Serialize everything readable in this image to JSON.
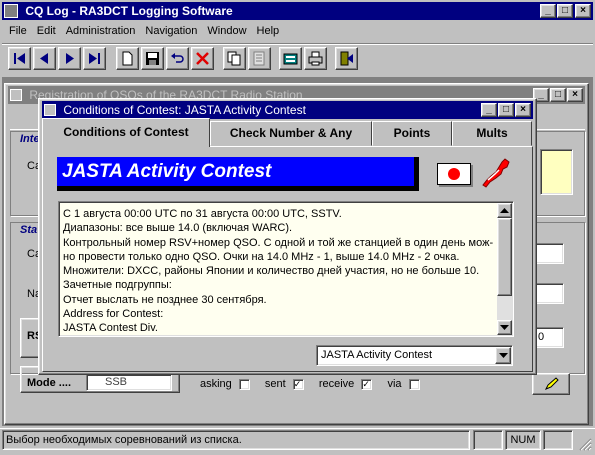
{
  "app": {
    "title": "CQ Log - RA3DCT Logging Software",
    "menu": [
      "File",
      "Edit",
      "Administration",
      "Navigation",
      "Window",
      "Help"
    ]
  },
  "background_window": {
    "title": "Registration of QSOs of the RA3DCT Radio Station",
    "group_top_label": "Inte",
    "row_label_c1": "Ca",
    "group_mid_label": "Sta",
    "row_label_c2": "Ca",
    "row_label_na": "Na",
    "row_label_rs": "RS",
    "mode_label": "Mode ....",
    "mode_value": "SSB",
    "check_asking": "asking",
    "check_sent": "sent",
    "check_receive": "receive",
    "check_via": "via",
    "side_value": "0"
  },
  "dialog": {
    "title": "Conditions of Contest: JASTA Activity Contest",
    "tabs": [
      "Conditions of Contest",
      "Check Number & Any",
      "Points",
      "Mults"
    ],
    "banner_title": "JASTA Activity Contest",
    "banner_color": "#0000ff",
    "flag_color": "#ff0000",
    "rules_lines": [
      "С 1 августа 00:00 UTC по 31 августа 00:00 UTC, SSTV.",
      "Диапазоны: все выше 14.0 (включая WARC).",
      "Контрольный номер RSV+номер QSO. С одной и той же станцией в один день мож-",
      "но провести только одно QSO. Очки на 14.0 MHz - 1, выше 14.0 MHz - 2 очка.",
      "Множители: DXCC, районы Японии и количество дней участия, но не больше 10.",
      "Зачетные подгруппы:",
      "Отчет выслать не позднее 30 сентября.",
      "Address for Contest:",
      "JASTA Contest Div."
    ],
    "contest_select": "JASTA Activity Contest"
  },
  "status_bar": {
    "message": "Выбор необходимых соревнований из списка.",
    "num": "NUM"
  }
}
